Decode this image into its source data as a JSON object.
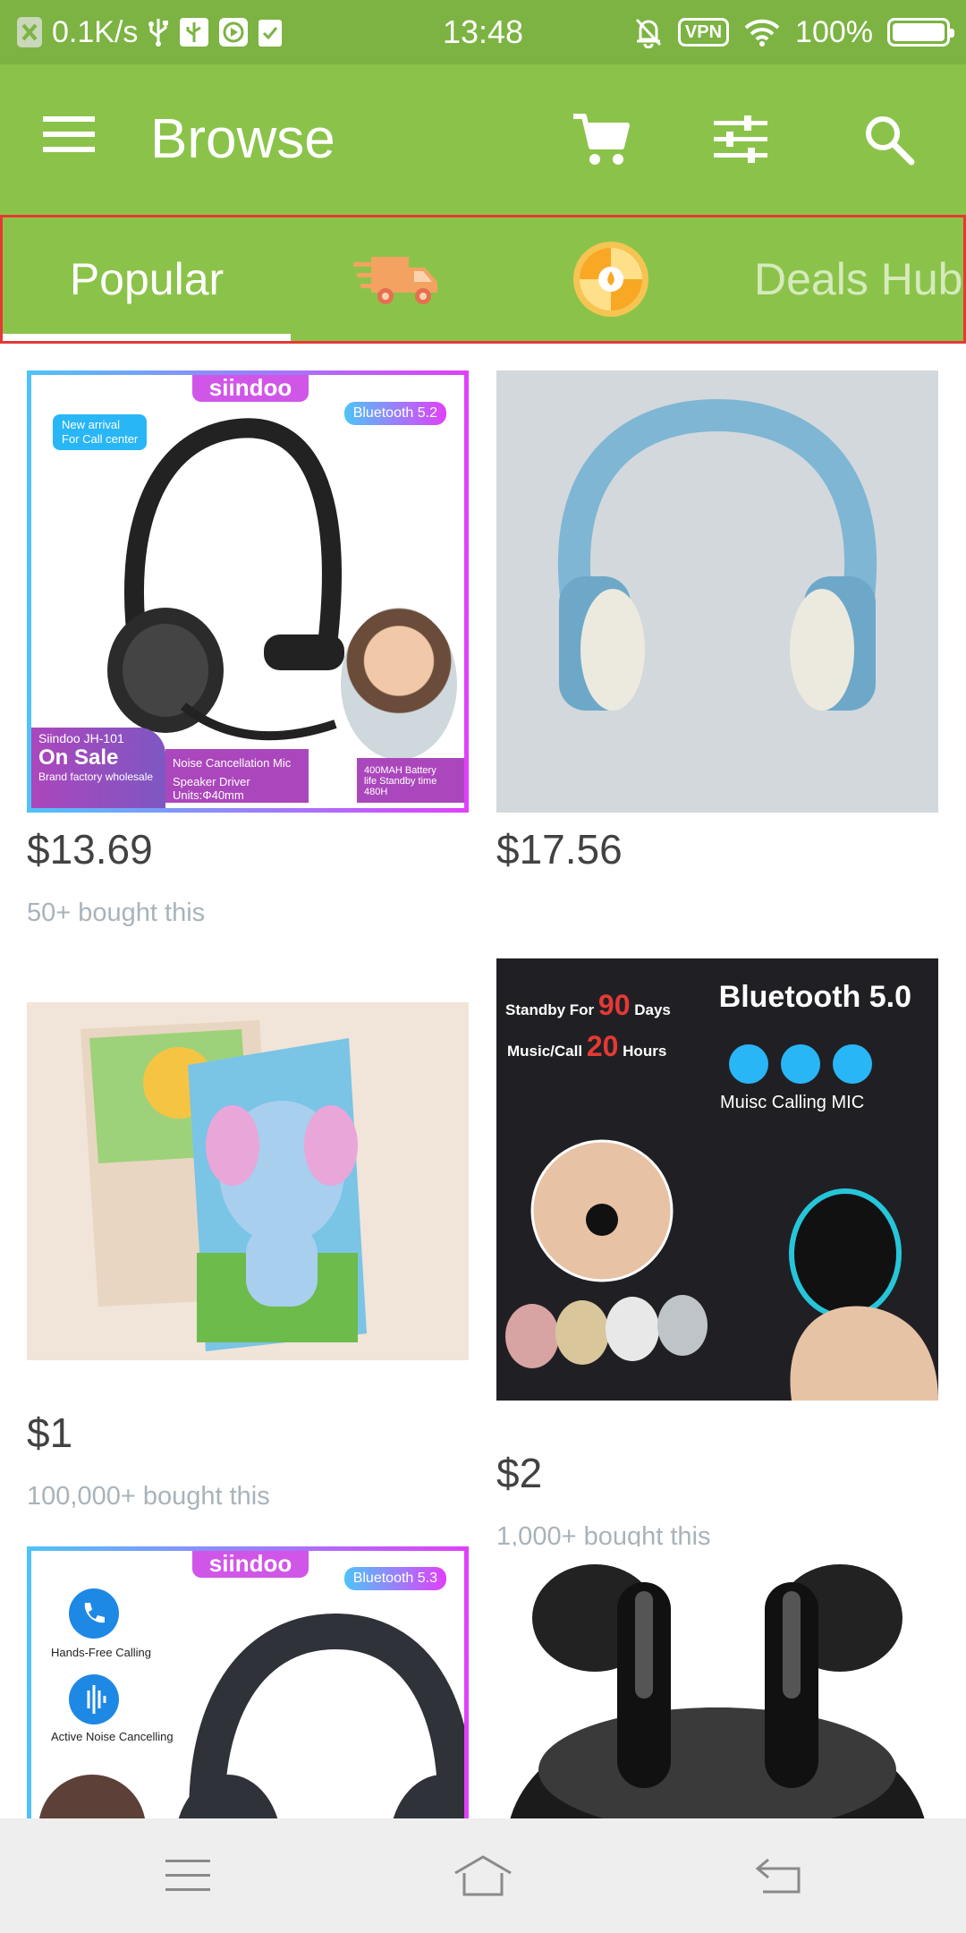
{
  "status_bar": {
    "net_speed": "0.1K/s",
    "time": "13:48",
    "vpn": "VPN",
    "battery": "100%"
  },
  "app_bar": {
    "title": "Browse"
  },
  "tabs": [
    {
      "label": "Popular",
      "selected": true
    },
    {
      "label": "",
      "icon": "delivery-truck-icon"
    },
    {
      "label": "",
      "icon": "coin-icon"
    },
    {
      "label": "Deals Hub"
    }
  ],
  "products": [
    {
      "price": "$13.69",
      "bought": "50+ bought this",
      "image": {
        "brand": "siindoo",
        "badge": "Bluetooth 5.2",
        "new_arrival": "New arrival",
        "for_call": "For Call center",
        "model": "Siindoo JH-101",
        "on_sale": "On Sale",
        "wholesale": "Brand factory wholesale",
        "noise": "Noise Cancellation Mic",
        "driver": "Speaker Driver Units:Φ40mm",
        "battery1": "400MAH Battery",
        "battery2": "life Standby time 480H"
      }
    },
    {
      "price": "$17.56",
      "bought": ""
    },
    {
      "price": "$1",
      "bought": "100,000+ bought this"
    },
    {
      "price": "$2",
      "bought": "1,000+ bought this",
      "image": {
        "standby_a": "Standby For",
        "standby_num": "90",
        "standby_b": "Days",
        "music_a": "Music/Call",
        "music_num": "20",
        "music_b": "Hours",
        "bt": "Bluetooth 5.0",
        "features": "Muisc Calling  MIC"
      }
    },
    {
      "price": "",
      "bought": "",
      "image": {
        "brand": "siindoo",
        "badge": "Bluetooth 5.3",
        "handsfree": "Hands-Free Calling",
        "anc": "Active Noise Cancelling"
      }
    },
    {
      "price": "",
      "bought": ""
    }
  ],
  "colors": {
    "status_bar": "#7cb342",
    "app_bar": "#8bc34a",
    "tab_highlight_border": "#e53935",
    "price_text": "#424242",
    "bought_text": "#a8b3ba"
  }
}
